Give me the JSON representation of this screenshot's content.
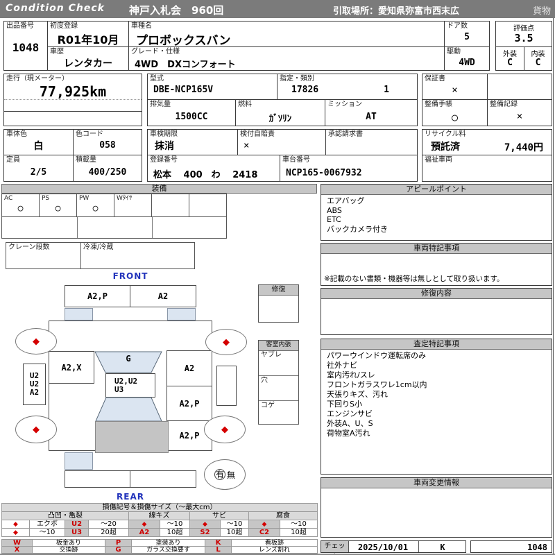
{
  "colors": {
    "header_bar": "#7b7b7b",
    "section_bar": "#c6c6c6",
    "accent_red": "#cc0000",
    "direction_blue": "#2233bb",
    "glass_blue": "#dbe5f1",
    "cargo_gray": "#c4c4c4",
    "damage_mark_red": "#d40000"
  },
  "header": {
    "brand": "Condition  Check",
    "auction": "神戸入札会　960回",
    "pickup": "引取場所：愛知県弥富市西末広",
    "cargo": "貨物"
  },
  "info": {
    "lot_label": "出品番号",
    "lot_value": "1048",
    "first_reg_label": "初度登録",
    "first_reg_value": "R01年10月",
    "model_name_label": "車種名",
    "model_name_value": "プロボックスバン",
    "doors_label": "ドア数",
    "doors_value": "5",
    "score_label": "評価点",
    "score_value": "3.5",
    "history_label": "車歴",
    "history_value": "レンタカー",
    "grade_label": "グレード・仕様",
    "grade_value": "4WD　DXコンフォート",
    "drive_label": "駆動",
    "drive_value": "4WD",
    "exterior_label": "外装",
    "exterior_value": "C",
    "interior_label": "内装",
    "interior_value": "C",
    "mileage_label": "走行（現メーター）",
    "mileage_value": "77,925km",
    "model_code_label": "型式",
    "model_code_value": "DBE-NCP165V",
    "class_label": "指定・類別",
    "class_value1": "17826",
    "class_value2": "1",
    "warranty_label": "保証書",
    "warranty_value": "×",
    "displacement_label": "排気量",
    "displacement_value": "1500CC",
    "fuel_label": "燃料",
    "fuel_value": "ｶﾞｿﾘﾝ",
    "mission_label": "ミッション",
    "mission_value": "AT",
    "maint_book_label": "整備手帳",
    "maint_book_value": "○",
    "maint_rec_label": "整備記録",
    "maint_rec_value": "×",
    "body_color_label": "車体色",
    "body_color_value": "白",
    "color_code_label": "色コード",
    "color_code_value": "058",
    "inspection_label": "車検期限",
    "inspection_value": "抹消",
    "insurance_label": "検付自賠責",
    "insurance_value": "×",
    "approval_label": "承認請求書",
    "recycle_label": "リサイクル料",
    "recycle_status": "預託済",
    "recycle_fee": "7,440円",
    "capacity_label": "定員",
    "capacity_value": "2/5",
    "load_label": "積載量",
    "load_value": "400/250",
    "reg_no_label": "登録番号",
    "reg_no_value": "松本　 400　わ　 2418",
    "chassis_label": "車台番号",
    "chassis_value": "NCP165-0067932",
    "welfare_label": "福祉車両"
  },
  "equipment": {
    "title": "装備",
    "cells": [
      {
        "label": "AC",
        "value": "○"
      },
      {
        "label": "PS",
        "value": "○"
      },
      {
        "label": "PW",
        "value": "○"
      },
      {
        "label": "Wﾀｲﾔ",
        "value": ""
      },
      {
        "label": "",
        "value": ""
      },
      {
        "label": "",
        "value": ""
      }
    ],
    "crane_label": "クレーン段数",
    "fridge_label": "冷凍/冷蔵"
  },
  "diagram": {
    "front_label": "FRONT",
    "rear_label": "REAR",
    "wheel_mark": "◆",
    "front_bumper_left": "A2,P",
    "front_bumper_right": "A2",
    "left_fender": "A2,X",
    "windshield": "G",
    "roof_line1": "U2,U2",
    "roof_line2": "U3",
    "right_fender": "A2",
    "right_door": "A2,P",
    "right_quarter": "A2,P",
    "left_side": [
      "U2",
      "U2",
      "A2"
    ],
    "spare_have": "有",
    "spare_none": "無",
    "repair_box_title": "修復",
    "interior_box_title": "客室内張",
    "interior_rows": [
      "ヤブレ",
      "穴",
      "コゲ"
    ]
  },
  "right_panel": {
    "appeal": {
      "title": "アピールポイント",
      "items": [
        "エアバッグ",
        "ABS",
        "ETC",
        "バックカメラ付き"
      ]
    },
    "vehicle_notes": {
      "title": "車両特記事項",
      "footnote": "※記載のない書類・機器等は無しとして取り扱います。"
    },
    "repair_details": {
      "title": "修復内容"
    },
    "assessment": {
      "title": "査定特記事項",
      "items": [
        "パワーウインドウ運転席のみ",
        "社外ナビ",
        "室内汚れ/スレ",
        "フロントガラスワレ1cm以内",
        "天張りキズ、汚れ",
        "下回りS小",
        "エンジンサビ",
        "外装A、U、S",
        "荷物室A汚れ"
      ]
    },
    "change_info": {
      "title": "車両変更情報"
    },
    "check": {
      "label": "チェック",
      "date": "2025/10/01",
      "inspector": "K",
      "lot": "1048"
    }
  },
  "legend": {
    "title": "損傷記号＆損傷サイズ（～最大cm）",
    "group_dent": "凸凹・亀裂",
    "group_scratch": "線キズ",
    "group_rust": "サビ",
    "group_corrosion": "腐食",
    "dent_r1": [
      "◆",
      "エクボ",
      "U2",
      "～20"
    ],
    "dent_r2": [
      "◆",
      "～10",
      "U3",
      "20超"
    ],
    "scratch_r1": [
      "◆",
      "～10"
    ],
    "scratch_r2": [
      "A2",
      "10超"
    ],
    "rust_r1": [
      "◆",
      "～10"
    ],
    "rust_r2": [
      "S2",
      "10超"
    ],
    "corr_r1": [
      "◆",
      "～10"
    ],
    "corr_r2": [
      "C2",
      "10超"
    ],
    "codes": [
      {
        "code": "W",
        "label": "板金あり"
      },
      {
        "code": "P",
        "label": "塗装あり"
      },
      {
        "code": "K",
        "label": "看板跡"
      },
      {
        "code": "X",
        "label": "交換跡"
      },
      {
        "code": "G",
        "label": "ガラス交換要す"
      },
      {
        "code": "L",
        "label": "レンズ割れ"
      }
    ]
  }
}
